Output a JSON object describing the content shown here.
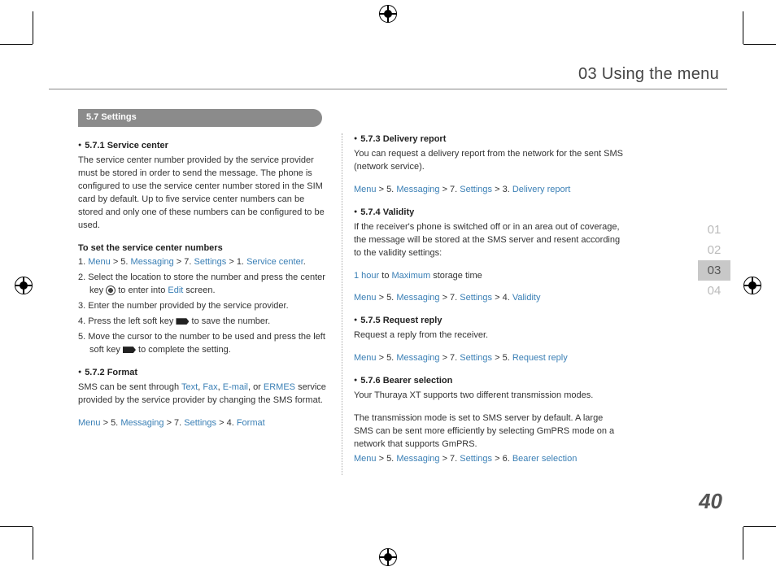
{
  "header": {
    "title": "03 Using the menu"
  },
  "sideTabs": {
    "t1": "01",
    "t2": "02",
    "t3": "03",
    "t4": "04"
  },
  "pageNumber": "40",
  "section": {
    "tab": "5.7  Settings"
  },
  "col1": {
    "s571": {
      "head": "5.7.1  Service center",
      "body": "The service center number provided by the service provider must be stored in order to send the message. The phone is configured to use the service center number stored in the SIM card by default. Up to five service center numbers can be stored and only one of these numbers can be configured to be used."
    },
    "setNumbers": {
      "head": "To set the service center numbers",
      "step1a": "1. ",
      "step1_path": {
        "menu": "Menu",
        "n5": " > 5. ",
        "messaging": "Messaging",
        "n7": " > 7. ",
        "settings": "Settings",
        "n1": " > 1. ",
        "sc": "Service center",
        "dot": "."
      },
      "step2a": "2. Select the location to store the number and press the center key ",
      "step2b": " to enter into ",
      "step2_edit": "Edit",
      "step2c": " screen.",
      "step3": "3. Enter the number provided by the service provider.",
      "step4a": "4. Press the left soft key ",
      "step4b": " to save the number.",
      "step5a": "5. Move the cursor to the number to be used and press the left soft key ",
      "step5b": " to complete the setting."
    },
    "s572": {
      "head": "5.7.2  Format",
      "body_a": "SMS can be sent through ",
      "types": {
        "text": "Text",
        "sep1": ", ",
        "fax": "Fax",
        "sep2": ", ",
        "email": "E-mail",
        "sep3": ", or ",
        "ermes": "ERMES"
      },
      "body_b": " service provided by the service provider by changing the SMS format.",
      "path": {
        "menu": "Menu",
        "n5": " > 5. ",
        "messaging": "Messaging",
        "n7": " > 7. ",
        "settings": "Settings",
        "n4": " > 4. ",
        "format": "Format"
      }
    }
  },
  "col2": {
    "s573": {
      "head": "5.7.3  Delivery report",
      "body": "You can request a delivery report from the network for the sent SMS (network service).",
      "path": {
        "menu": "Menu",
        "n5": " > 5. ",
        "messaging": "Messaging",
        "n7": " > 7. ",
        "settings": "Settings",
        "n3": " > 3. ",
        "dr": "Delivery report"
      }
    },
    "s574": {
      "head": "5.7.4  Validity",
      "body": "If the receiver's phone is switched off or in an area out of coverage, the message will be stored at the SMS server and resent according to the validity settings:",
      "range_a": "1 hour",
      "range_mid": " to ",
      "range_b": "Maximum",
      "range_c": " storage time",
      "path": {
        "menu": "Menu",
        "n5": " > 5. ",
        "messaging": "Messaging",
        "n7": " > 7. ",
        "settings": "Settings",
        "n4": " > 4. ",
        "validity": "Validity"
      }
    },
    "s575": {
      "head": "5.7.5  Request reply",
      "body": "Request a reply from the receiver.",
      "path": {
        "menu": "Menu",
        "n5": " > 5. ",
        "messaging": "Messaging",
        "n7": " > 7. ",
        "settings": "Settings",
        "n5b": " > 5. ",
        "rr": "Request reply"
      }
    },
    "s576": {
      "head": "5.7.6  Bearer selection",
      "body1": "Your Thuraya XT supports two different transmission modes.",
      "body2": "The transmission mode is set to SMS server by default. A large SMS can be sent more efficiently by selecting GmPRS mode on a network that supports GmPRS.",
      "path": {
        "menu": "Menu",
        "n5": " > 5. ",
        "messaging": "Messaging",
        "n7": " > 7. ",
        "settings": "Settings",
        "n6": " > 6. ",
        "bs": "Bearer selection"
      }
    }
  }
}
